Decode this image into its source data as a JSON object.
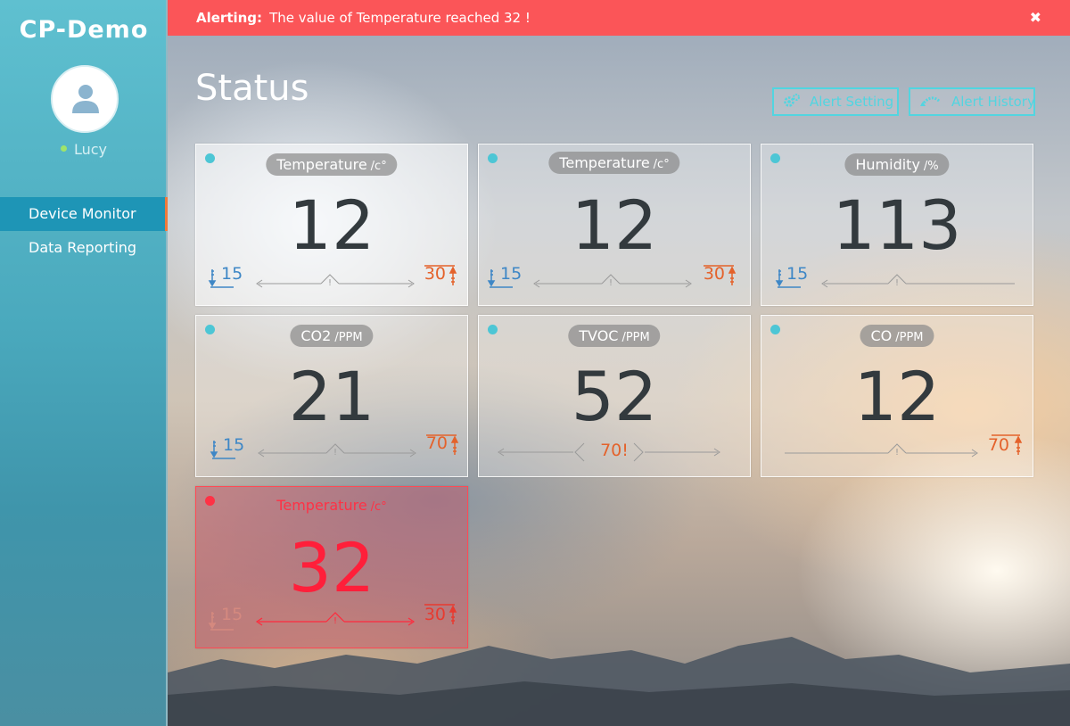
{
  "app": {
    "name": "CP-Demo"
  },
  "user": {
    "name": "Lucy",
    "status_color": "#9fe46a"
  },
  "nav": [
    {
      "label": "Device Monitor",
      "active": true
    },
    {
      "label": "Data Reporting",
      "active": false
    }
  ],
  "alert": {
    "prefix": "Alerting:",
    "message": "The value of Temperature reached 32 !",
    "close": "✖",
    "color": "#fb5558"
  },
  "page": {
    "title": "Status"
  },
  "buttons": {
    "alert_setting": "Alert Setting",
    "alert_history": "Alert History"
  },
  "cards": [
    {
      "label": "Temperature",
      "unit": "/c°",
      "value": "12",
      "low": "15",
      "high": "30",
      "state": "normal"
    },
    {
      "label": "Temperature",
      "unit": "/c°",
      "value": "12",
      "low": "15",
      "high": "30",
      "state": "normal"
    },
    {
      "label": "Humidity",
      "unit": "/%",
      "value": "113",
      "low": "15",
      "high": "",
      "state": "normal"
    },
    {
      "label": "CO2",
      "unit": "/PPM",
      "value": "21",
      "low": "15",
      "high": "70",
      "state": "normal"
    },
    {
      "label": "TVOC",
      "unit": "/PPM",
      "value": "52",
      "mid": "70!",
      "state": "normal"
    },
    {
      "label": "CO",
      "unit": "/PPM",
      "value": "12",
      "low": "",
      "high": "70",
      "state": "normal"
    },
    {
      "label": "Temperature",
      "unit": "/c°",
      "value": "32",
      "low": "15",
      "high": "30",
      "state": "alert"
    }
  ],
  "colors": {
    "accent": "#52d5e0",
    "alert": "#ff3145",
    "low": "#3e87c6",
    "high": "#e4622b"
  }
}
